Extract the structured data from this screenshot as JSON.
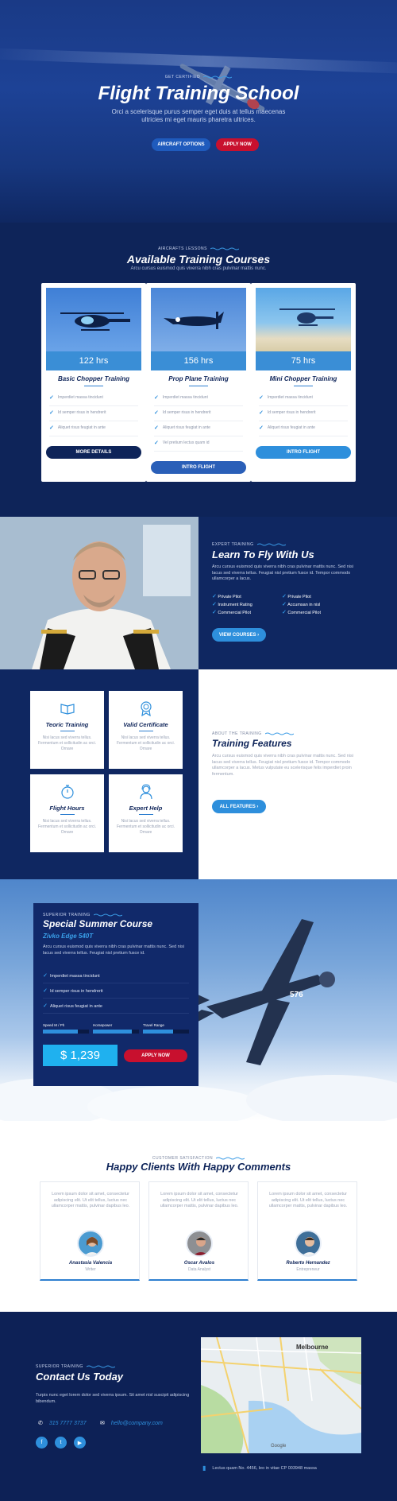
{
  "hero": {
    "eyebrow": "GET CERTIFIED",
    "title": "Flight Training School",
    "subtitle": "Orci a scelerisque purus semper eget duis at tellus maecenas ultricies mi eget mauris pharetra ultrices.",
    "btn_primary": "AIRCRAFT OPTIONS",
    "btn_secondary": "APPLY NOW"
  },
  "courses": {
    "eyebrow": "AIRCRAFTS LESSONS",
    "title": "Available Training Courses",
    "subtitle": "Arcu cursus euismod quis viverra nibh cras pulvinar mattis nunc.",
    "cards": [
      {
        "hours": "122 hrs",
        "title": "Basic Chopper Training",
        "features": [
          "Imperdiet massa tincidunt",
          "Id semper risus in hendrerit",
          "Aliquet risus feugiat in ante"
        ],
        "button": "MORE DETAILS"
      },
      {
        "hours": "156 hrs",
        "title": "Prop Plane Training",
        "features": [
          "Imperdiet massa tincidunt",
          "Id semper risus in hendrerit",
          "Aliquet risus feugiat in ante",
          "Vel pretium lectus quam id"
        ],
        "button": "INTRO FLIGHT"
      },
      {
        "hours": "75 hrs",
        "title": "Mini Chopper Training",
        "features": [
          "Imperdiet massa tincidunt",
          "Id semper risus in hendrerit",
          "Aliquet risus feugiat in ante"
        ],
        "button": "INTRO FLIGHT"
      }
    ]
  },
  "learn": {
    "eyebrow": "EXPERT TRAINING",
    "title": "Learn To Fly With Us",
    "body": "Arcu cursus euismod quis viverra nibh cras pulvinar mattis nunc. Sed nisi lacus sed viverra tellus. Feugiat nisl pretium fusce id. Tempor commodo ullamcorper a lacus.",
    "list_left": [
      "Private Pilot",
      "Instrument Rating",
      "Commercial Pilot"
    ],
    "list_right": [
      "Private Pilot",
      "Accumsan in nisl",
      "Commercial Pilot"
    ],
    "button": "VIEW COURSES"
  },
  "features": {
    "boxes": [
      {
        "title": "Teoric Training",
        "desc": "Nisi lacus sed viverra tellus. Fermentum et sollicitudin ac orci. Ornare"
      },
      {
        "title": "Valid Certificate",
        "desc": "Nisi lacus sed viverra tellus. Fermentum et sollicitudin ac orci. Ornare"
      },
      {
        "title": "Flight Hours",
        "desc": "Nisi lacus sed viverra tellus. Fermentum et sollicitudin ac orci. Ornare"
      },
      {
        "title": "Expert Help",
        "desc": "Nisi lacus sed viverra tellus. Fermentum et sollicitudin ac orci. Ornare"
      }
    ],
    "eyebrow": "ABOUT THE TRAINING",
    "title": "Training Features",
    "body": "Arcu cursus euismod quis viverra nibh cras pulvinar mattis nunc. Sed nisi lacus sed viverra tellus. Feugiat nisl pretium fusce id. Tempor commodo ullamcorper a lacus. Metus vulputate eu scelerisque felis imperdiet proin fermentum.",
    "button": "ALL FEATURES"
  },
  "summer": {
    "eyebrow": "SUPERIOR TRAINING",
    "title": "Special Summer Course",
    "plane": "Zivko Edge 540T",
    "body": "Arcu cursus euismod quis viverra nibh cras pulvinar mattis nunc. Sed nisi lacus sed viverra tellus. Feugiat nisl pretium fusce id.",
    "features": [
      "Imperdiet massa tincidunt",
      "Id semper risus in hendrerit",
      "Aliquet risus feugiat in ante"
    ],
    "stats": [
      {
        "label": "Speed M / Ph",
        "value": 0.75
      },
      {
        "label": "Horsepower",
        "value": 0.85
      },
      {
        "label": "Travel Range",
        "value": 0.65
      }
    ],
    "price": "$ 1,239",
    "button": "APPLY NOW"
  },
  "testimonials": {
    "eyebrow": "CUSTOMER SATISFACTION",
    "title": "Happy Clients With Happy Comments",
    "items": [
      {
        "quote": "Lorem ipsum dolor sit amet, consectetur adipiscing elit. Ut elit tellus, luctus nec ullamcorper mattis, pulvinar dapibus leo.",
        "name": "Anastasia Valencia",
        "role": "Writer"
      },
      {
        "quote": "Lorem ipsum dolor sit amet, consectetur adipiscing elit. Ut elit tellus, luctus nec ullamcorper mattis, pulvinar dapibus leo.",
        "name": "Oscar Avalos",
        "role": "Data Analyst"
      },
      {
        "quote": "Lorem ipsum dolor sit amet, consectetur adipiscing elit. Ut elit tellus, luctus nec ullamcorper mattis, pulvinar dapibus leo.",
        "name": "Roberto Hernandez",
        "role": "Entrepreneur"
      }
    ]
  },
  "contact": {
    "eyebrow": "SUPERIOR TRAINING",
    "title": "Contact Us Today",
    "body": "Turpis nunc eget lorem dolor sed viverra ipsum. Sit amet nisl suscipit adipiscing bibendum.",
    "phone": "315 7777 3737",
    "email": "hello@company.com",
    "address": "Lectus quam No. 4456, leo in vitae CP 003948 massa",
    "map_city": "Melbourne",
    "map_credit": "Google"
  },
  "colors": {
    "navy": "#0e2459",
    "accent": "#2e8fdc",
    "red": "#c8102e"
  }
}
